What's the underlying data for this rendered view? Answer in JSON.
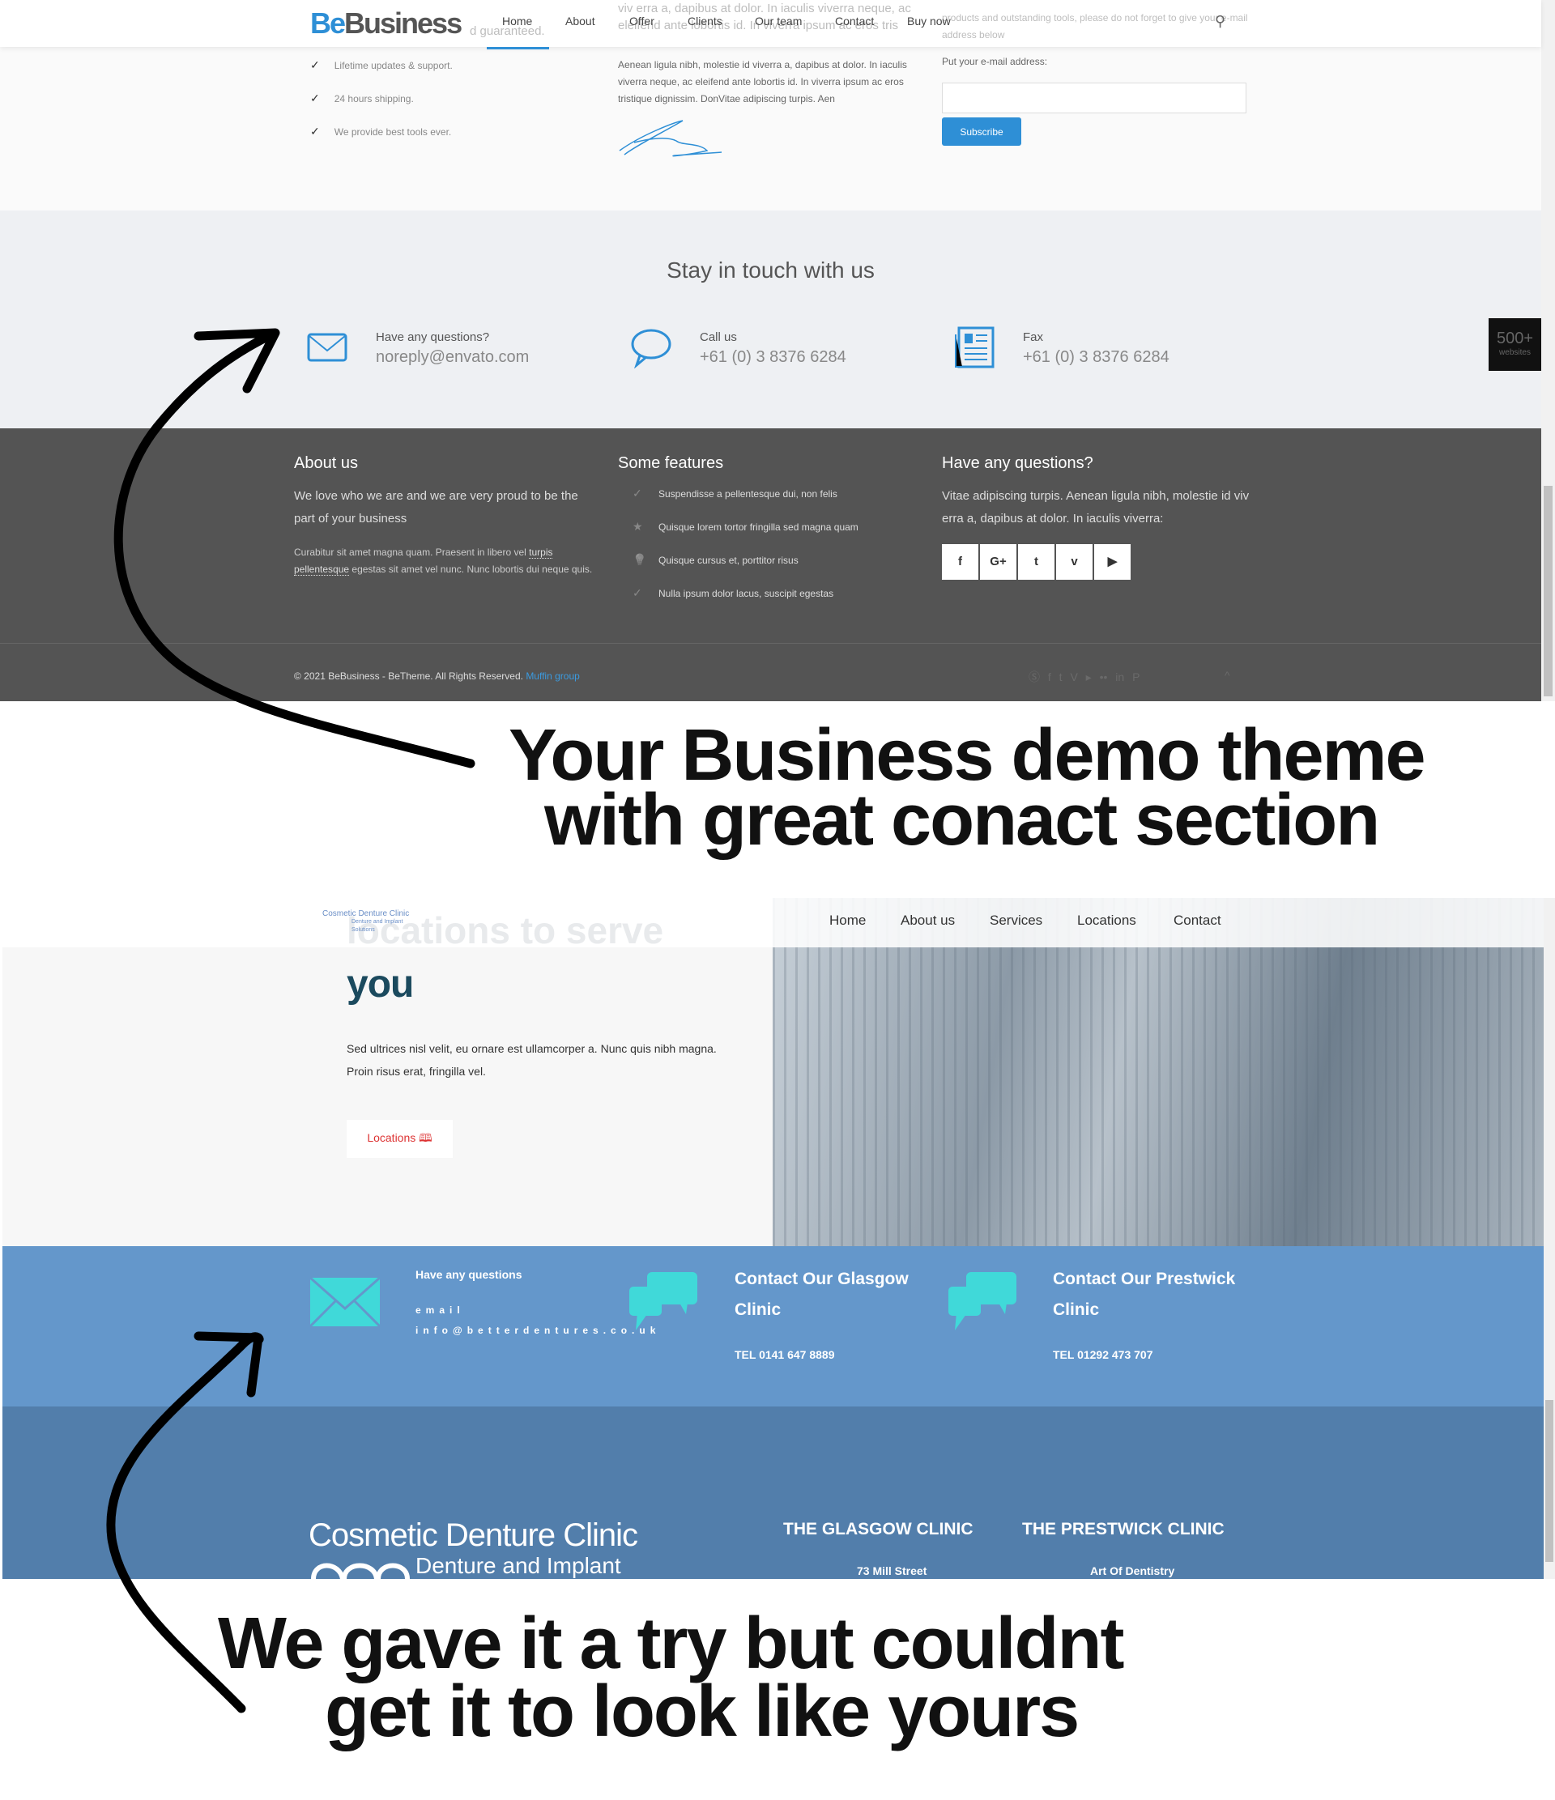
{
  "top": {
    "logo": {
      "be": "Be",
      "business": "Business"
    },
    "nav": [
      "Home",
      "About",
      "Offer",
      "Clients",
      "Our team",
      "Contact",
      "Buy now"
    ],
    "features": [
      "Lifetime updates & support.",
      "24 hours shipping.",
      "We provide best tools ever."
    ],
    "ghost_left": "d guaranteed.",
    "ghost_mid": "viv erra a, dapibus at dolor. In iaculis viverra neque, ac eleifend ante lobortis id. In viverra ipsum ac eros tris",
    "ghost_right": "products and outstanding tools, please do not forget to give your e-mail address below",
    "mid_text": "Aenean ligula nibh, molestie id viverra a, dapibus at dolor. In iaculis viverra neque, ac eleifend ante lobortis id. In viverra ipsum ac eros tristique dignissim. DonVitae adipiscing turpis. Aen",
    "email_label": "Put your e-mail address:",
    "subscribe": "Subscribe"
  },
  "stay": {
    "title": "Stay in touch with us",
    "items": [
      {
        "label": "Have any questions?",
        "value": "noreply@envato.com",
        "icon": "envelope-icon"
      },
      {
        "label": "Call us",
        "value": "+61 (0) 3 8376 6284",
        "icon": "speech-bubble-icon"
      },
      {
        "label": "Fax",
        "value": "+61 (0) 3 8376 6284",
        "icon": "fax-icon"
      }
    ],
    "badge": {
      "num": "500+",
      "txt": "websites"
    }
  },
  "footer": {
    "about_h": "About us",
    "about_t": "We love who we are and we are very proud to be the part of your business",
    "about_s1": "Curabitur sit amet magna quam. Praesent in libero vel ",
    "about_link": "turpis pellentesque",
    "about_s2": " egestas sit amet vel nunc. Nunc lobortis dui neque quis.",
    "feat_h": "Some features",
    "feats": [
      {
        "t": "Suspendisse a pellentesque dui, non felis",
        "i": "✓"
      },
      {
        "t": "Quisque lorem tortor fringilla sed magna quam",
        "i": "★"
      },
      {
        "t": "Quisque cursus et, porttitor risus",
        "i": "💡"
      },
      {
        "t": "Nulla ipsum dolor lacus, suscipit egestas",
        "i": "✓"
      }
    ],
    "q_h": "Have any questions?",
    "q_t": "Vitae adipiscing turpis. Aenean ligula nibh, molestie id viv erra a, dapibus at dolor. In iaculis viverra:",
    "social": [
      "f",
      "G+",
      "t",
      "v",
      "▶"
    ],
    "copy": "© 2021 BeBusiness - BeTheme. All Rights Reserved. ",
    "copy_link": "Muffin group",
    "bottom_social": "Ⓢ  f  t  V  ▸  ••  in  P",
    "top_arrow": "^"
  },
  "caption1": [
    "Your Business demo theme",
    "with great conact section"
  ],
  "site2": {
    "logo": {
      "l1": "Cosmetic Denture Clinic",
      "l2": "Denture and Implant",
      "l3": "Solutions"
    },
    "nav": [
      "Home",
      "About us",
      "Services",
      "Locations",
      "Contact"
    ],
    "ghost": "locations to serve",
    "heading": "you",
    "para": "Sed ultrices nisl velit, eu ornare est ullamcorper a. Nunc quis nibh magna. Proin risus erat, fringilla vel.",
    "button": "Locations",
    "q": "Have any questions",
    "email_label": "email",
    "email": "info@betterdentures.co.uk",
    "glasgow": {
      "h": "Contact Our Glasgow Clinic",
      "tel": "TEL 0141 647 8889"
    },
    "prestwick": {
      "h": "Contact Our Prestwick Clinic",
      "tel": "TEL 01292 473 707"
    },
    "footer_logo": {
      "l1": "Cosmetic Denture Clinic",
      "l2": "Denture and Implant"
    },
    "clinics": [
      {
        "h": "THE GLASGOW CLINIC",
        "a": "73 Mill Street"
      },
      {
        "h": "THE PRESTWICK CLINIC",
        "a": "Art Of Dentistry"
      }
    ],
    "accent": "#40d9d9"
  },
  "caption2": [
    "We gave it a try but couldnt",
    "get it to look like yours"
  ]
}
